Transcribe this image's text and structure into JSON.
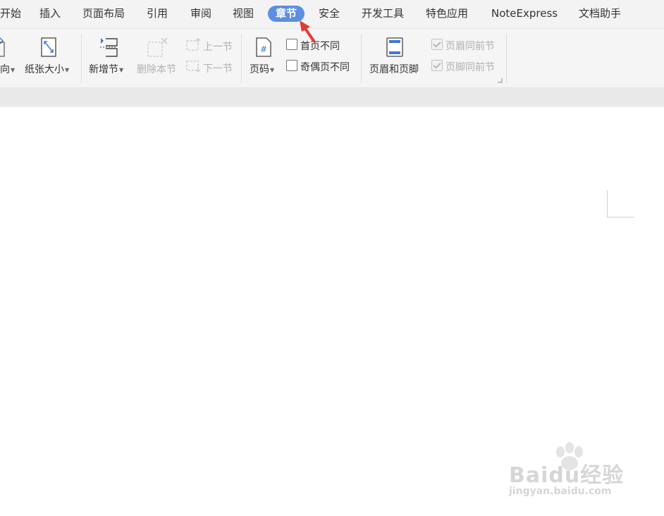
{
  "tabs": [
    {
      "label": "开始",
      "active": false
    },
    {
      "label": "插入",
      "active": false
    },
    {
      "label": "页面布局",
      "active": false
    },
    {
      "label": "引用",
      "active": false
    },
    {
      "label": "审阅",
      "active": false
    },
    {
      "label": "视图",
      "active": false
    },
    {
      "label": "章节",
      "active": true
    },
    {
      "label": "安全",
      "active": false
    },
    {
      "label": "开发工具",
      "active": false
    },
    {
      "label": "特色应用",
      "active": false
    },
    {
      "label": "NoteExpress",
      "active": false
    },
    {
      "label": "文档助手",
      "active": false
    }
  ],
  "ribbon": {
    "orientation_label": "向",
    "paper_size_label": "纸张大小",
    "new_section_label": "新增节",
    "delete_section_label": "删除本节",
    "prev_section_label": "上一节",
    "next_section_label": "下一节",
    "page_number_label": "页码",
    "first_page_diff_label": "首页不同",
    "odd_even_diff_label": "奇偶页不同",
    "header_footer_label": "页眉和页脚",
    "header_same_prev_label": "页眉同前节",
    "footer_same_prev_label": "页脚同前节"
  },
  "watermark": {
    "main": "Baidu经验",
    "sub": "jingyan.baidu.com"
  },
  "colors": {
    "active_tab": "#5c8fe0",
    "annotation_arrow": "#e53935",
    "icon_accent": "#3c78d8"
  }
}
